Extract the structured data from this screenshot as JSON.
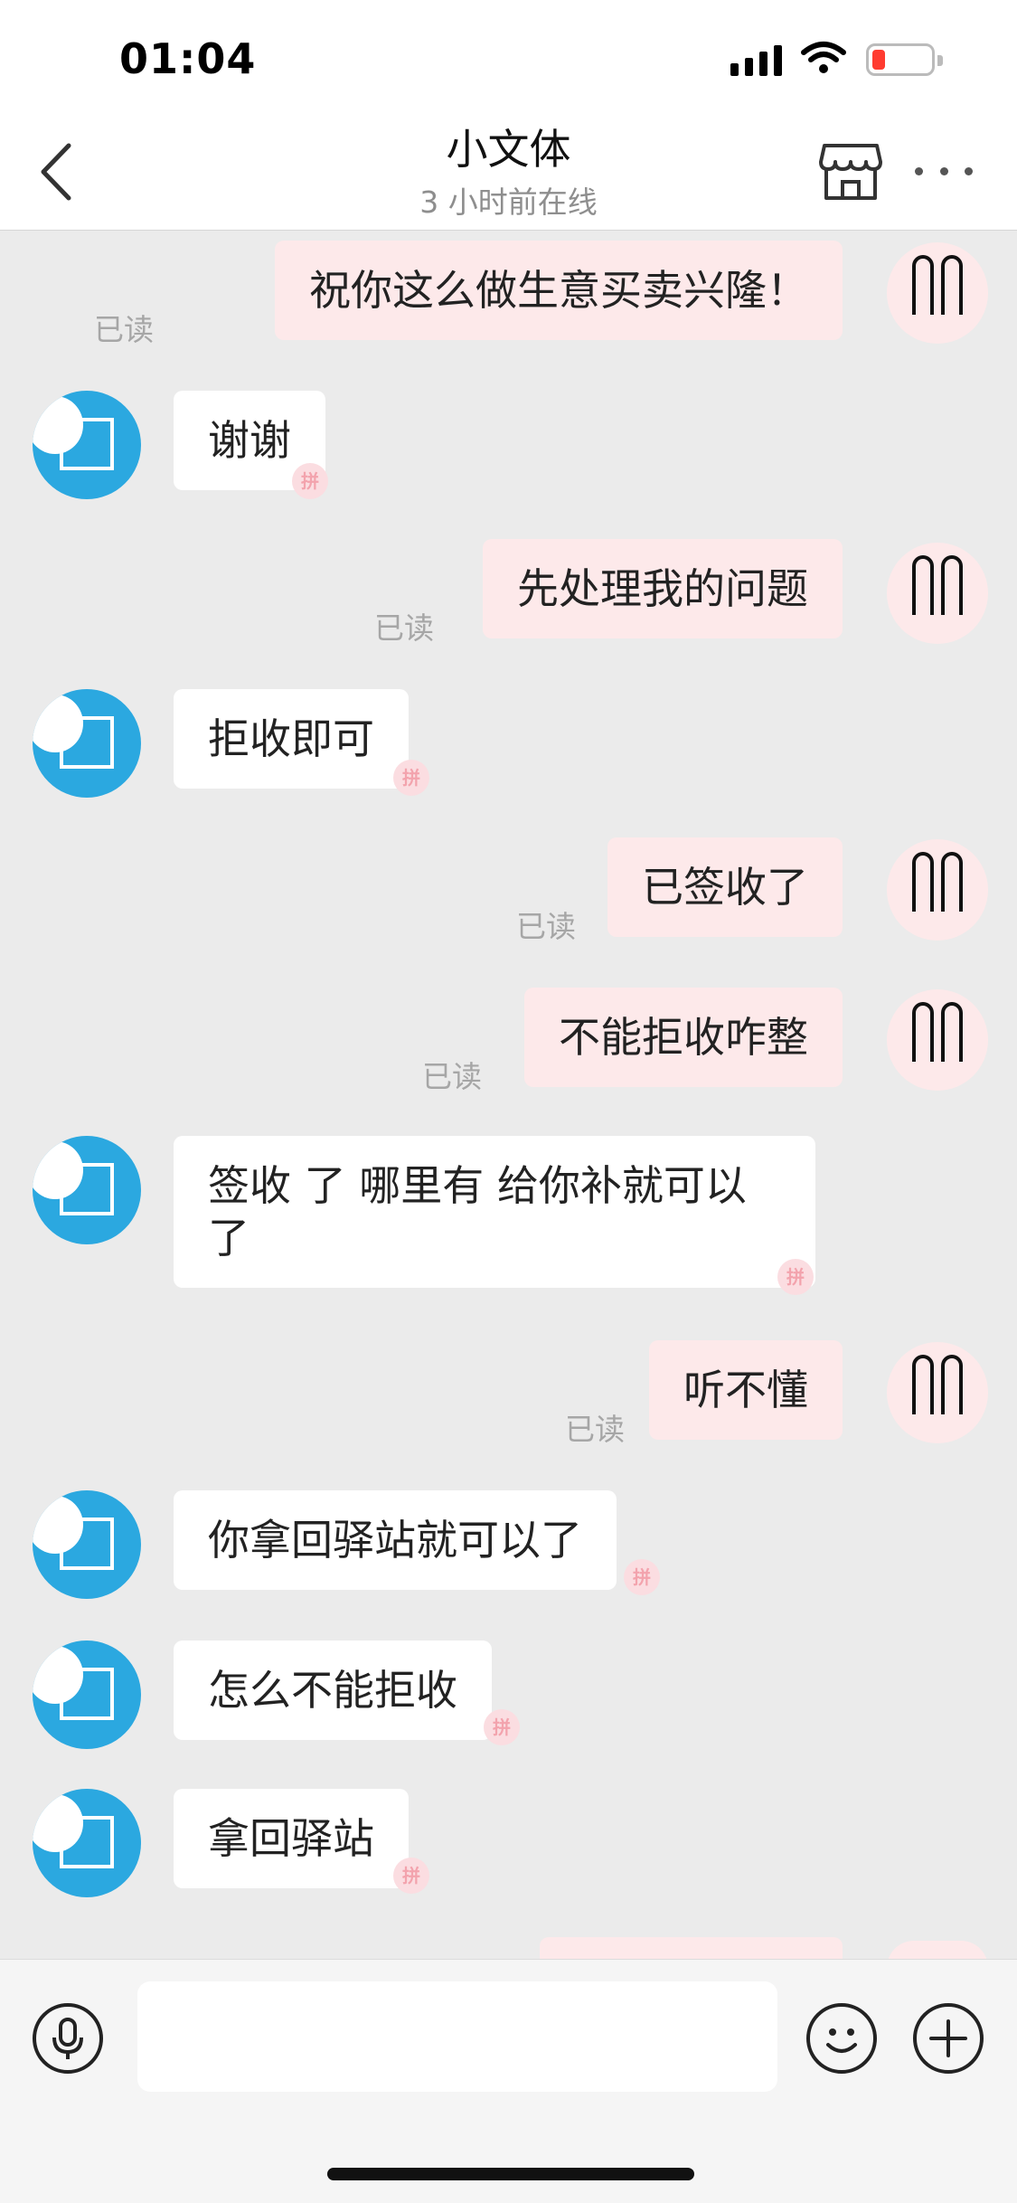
{
  "status_bar": {
    "time": "01:04",
    "icons": [
      "cellular-signal-icon",
      "wifi-icon",
      "battery-low-icon"
    ],
    "battery_color": "#ff3b30"
  },
  "header": {
    "title": "小文体",
    "subtitle": "3 小时前在线",
    "icons": [
      "back-chevron-icon",
      "store-icon",
      "more-icon"
    ]
  },
  "colors": {
    "chat_background": "#ebebeb",
    "outgoing_bubble": "#fde9ea",
    "incoming_bubble": "#ffffff",
    "avatar_blue": "#2ba8e0"
  },
  "messages": [
    {
      "direction": "out",
      "text": "祝你这么做生意买卖兴隆！",
      "status": "已读"
    },
    {
      "direction": "in",
      "text": "谢谢"
    },
    {
      "direction": "out",
      "text": "先处理我的问题",
      "status": "已读"
    },
    {
      "direction": "in",
      "text": "拒收即可"
    },
    {
      "direction": "out",
      "text": "已签收了",
      "status": "已读"
    },
    {
      "direction": "out",
      "text": "不能拒收咋整",
      "status": "已读"
    },
    {
      "direction": "in",
      "text": "签收 了  哪里有  给你补就可以了"
    },
    {
      "direction": "out",
      "text": "听不懂",
      "status": "已读"
    },
    {
      "direction": "in",
      "text": "你拿回驿站就可以了"
    },
    {
      "direction": "in",
      "text": "怎么不能拒收"
    },
    {
      "direction": "in",
      "text": "拿回驿站"
    }
  ],
  "input_bar": {
    "placeholder": "",
    "icons": [
      "microphone-icon",
      "emoji-icon",
      "plus-icon"
    ]
  }
}
